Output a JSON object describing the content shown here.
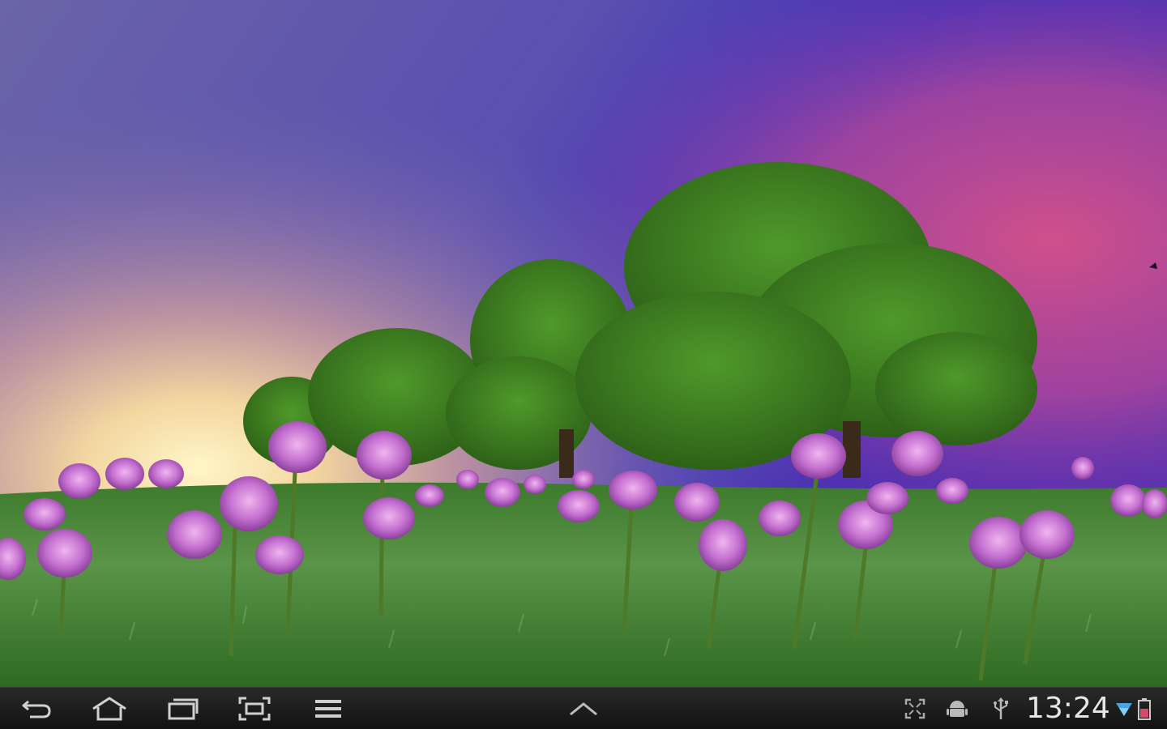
{
  "wallpaper": {
    "description_name": "clover-meadow-live-wallpaper",
    "colors": {
      "sky_top_left": "#6a64a8",
      "sky_top_right": "#3a2fb8",
      "sky_pink": "#c4508f",
      "sun_glow": "#fff2b0",
      "tree_green": "#3f7d1f",
      "grass_green": "#4d8a3a",
      "clover_pink": "#c46fd0"
    }
  },
  "navbar": {
    "background": "#1a1a1a",
    "icon_color": "#d0d0d0",
    "buttons": [
      {
        "name": "back-button",
        "icon": "back-arrow-icon"
      },
      {
        "name": "home-button",
        "icon": "home-icon"
      },
      {
        "name": "recent-apps-button",
        "icon": "recent-apps-icon"
      },
      {
        "name": "screenshot-button",
        "icon": "screenshot-icon"
      },
      {
        "name": "menu-button",
        "icon": "menu-icon"
      },
      {
        "name": "expand-panel-button",
        "icon": "chevron-up-icon"
      }
    ],
    "status": {
      "clock": "13:24",
      "icons": [
        "fullscreen-icon",
        "android-icon",
        "usb-icon",
        "wifi-icon",
        "battery-icon"
      ]
    }
  }
}
